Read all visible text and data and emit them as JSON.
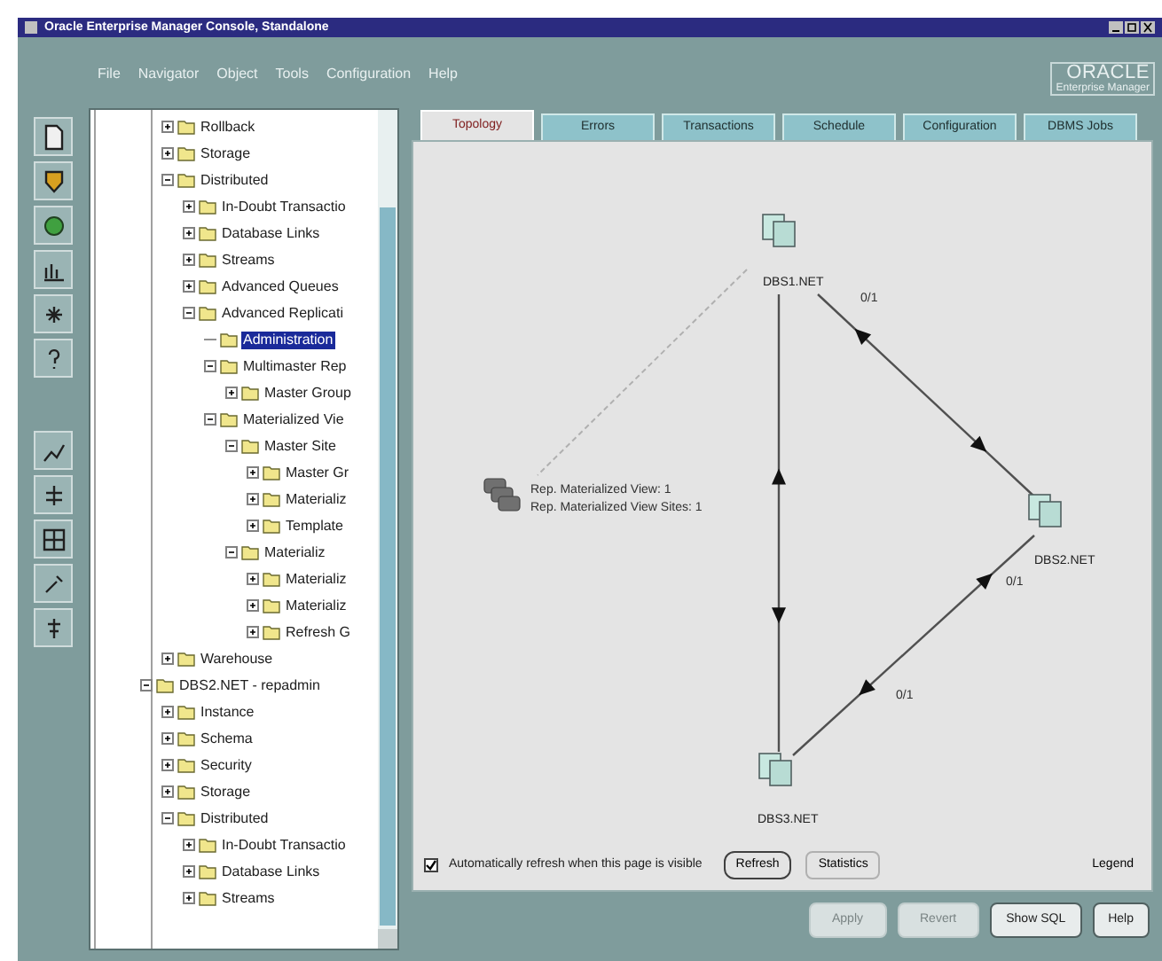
{
  "window": {
    "title": "Oracle Enterprise Manager Console, Standalone"
  },
  "menu": [
    "File",
    "Navigator",
    "Object",
    "Tools",
    "Configuration",
    "Help"
  ],
  "logo": {
    "brand": "ORACLE",
    "product": "Enterprise Manager"
  },
  "tree": {
    "items": [
      {
        "children": [
          {
            "label": "Rollback",
            "expanded": false
          },
          {
            "label": "Storage",
            "expanded": false
          },
          {
            "label": "Distributed",
            "expanded": true,
            "children": [
              {
                "label": "In-Doubt Transactio",
                "expanded": false
              },
              {
                "label": "Database Links",
                "expanded": false
              },
              {
                "label": "Streams",
                "expanded": false
              },
              {
                "label": "Advanced Queues",
                "expanded": false
              },
              {
                "label": "Advanced Replicati",
                "expanded": true,
                "children": [
                  {
                    "label": "Administration",
                    "selected": true
                  },
                  {
                    "label": "Multimaster Rep",
                    "expanded": true,
                    "children": [
                      {
                        "label": "Master Group",
                        "expanded": false
                      }
                    ]
                  },
                  {
                    "label": "Materialized Vie",
                    "expanded": true,
                    "children": [
                      {
                        "label": "Master Site",
                        "expanded": true,
                        "children": [
                          {
                            "label": "Master Gr",
                            "expanded": false
                          },
                          {
                            "label": "Materializ",
                            "expanded": false
                          },
                          {
                            "label": "Template",
                            "expanded": false
                          }
                        ]
                      },
                      {
                        "label": "Materializ",
                        "expanded": true,
                        "children": [
                          {
                            "label": "Materializ",
                            "expanded": false
                          },
                          {
                            "label": "Materializ",
                            "expanded": false
                          },
                          {
                            "label": "Refresh G",
                            "expanded": false
                          }
                        ]
                      }
                    ]
                  }
                ]
              }
            ]
          },
          {
            "label": "Warehouse",
            "expanded": false
          }
        ]
      },
      {
        "label": "DBS2.NET - repadmin",
        "expanded": true,
        "children": [
          {
            "label": "Instance",
            "expanded": false
          },
          {
            "label": "Schema",
            "expanded": false
          },
          {
            "label": "Security",
            "expanded": false
          },
          {
            "label": "Storage",
            "expanded": false
          },
          {
            "label": "Distributed",
            "expanded": true,
            "children": [
              {
                "label": "In-Doubt Transactio",
                "expanded": false
              },
              {
                "label": "Database Links",
                "expanded": false
              },
              {
                "label": "Streams",
                "expanded": false
              }
            ]
          }
        ]
      }
    ]
  },
  "tabs": [
    {
      "label": "Topology",
      "selected": true
    },
    {
      "label": "Errors",
      "selected": false
    },
    {
      "label": "Transactions",
      "selected": false
    },
    {
      "label": "Schedule",
      "selected": false
    },
    {
      "label": "Configuration",
      "selected": false
    },
    {
      "label": "DBMS Jobs",
      "selected": false
    }
  ],
  "topology": {
    "sites": [
      {
        "label": "DBS1.NET"
      },
      {
        "label": "DBS2.NET"
      },
      {
        "label": "DBS3.NET"
      }
    ],
    "mv_site": {
      "lines": [
        "Rep. Materialized View: 1",
        "Rep. Materialized View Sites: 1"
      ]
    },
    "edge_labels": [
      "0/1",
      "0/1",
      "0/1"
    ]
  },
  "auto_refresh": {
    "label": "Automatically refresh when this page is visible",
    "checked": true
  },
  "page_buttons": [
    {
      "label": "Refresh",
      "default": true
    },
    {
      "label": "Statistics",
      "default": false
    }
  ],
  "legend": "Legend",
  "dialog_buttons": [
    {
      "label": "Apply",
      "disabled": true
    },
    {
      "label": "Revert",
      "disabled": true
    },
    {
      "label": "Show SQL",
      "disabled": false
    },
    {
      "label": "Help",
      "disabled": false
    }
  ]
}
